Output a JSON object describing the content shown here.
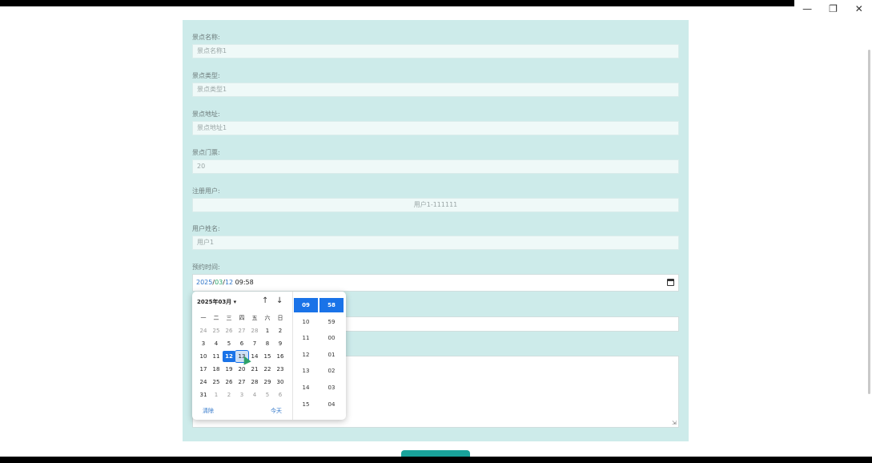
{
  "window": {
    "minimize_icon": "minimize-icon",
    "maximize_icon": "restore-icon",
    "close_icon": "close-icon"
  },
  "form": {
    "fields": [
      {
        "label": "景点名称:",
        "value": "景点名称1"
      },
      {
        "label": "景点类型:",
        "value": "景点类型1"
      },
      {
        "label": "景点地址:",
        "value": "景点地址1"
      },
      {
        "label": "景点门票:",
        "value": "20"
      },
      {
        "label": "注册用户:",
        "value": "用户1-111111"
      },
      {
        "label": "用户姓名:",
        "value": "用户1"
      },
      {
        "label": "预约时间:",
        "value": ""
      }
    ],
    "datetime": {
      "year": "2025",
      "sep1": "/",
      "month": "03",
      "sep2": "/",
      "day": "12",
      "time": " 09:58"
    }
  },
  "picker": {
    "month_label": "2025年03月 ▾",
    "nav_up": "↑",
    "nav_down": "↓",
    "weekdays": [
      "一",
      "二",
      "三",
      "四",
      "五",
      "六",
      "日"
    ],
    "days": [
      [
        "24",
        "25",
        "26",
        "27",
        "28",
        "1",
        "2"
      ],
      [
        "3",
        "4",
        "5",
        "6",
        "7",
        "8",
        "9"
      ],
      [
        "10",
        "11",
        "12",
        "13",
        "14",
        "15",
        "16"
      ],
      [
        "17",
        "18",
        "19",
        "20",
        "21",
        "22",
        "23"
      ],
      [
        "24",
        "25",
        "26",
        "27",
        "28",
        "29",
        "30"
      ],
      [
        "31",
        "1",
        "2",
        "3",
        "4",
        "5",
        "6"
      ]
    ],
    "selected_day": "12",
    "hover_day": "13",
    "clear_label": "清除",
    "today_label": "今天",
    "hours": [
      "09",
      "10",
      "11",
      "12",
      "13",
      "14",
      "15"
    ],
    "minutes": [
      "58",
      "59",
      "00",
      "01",
      "02",
      "03",
      "04"
    ],
    "selected_hour": "09",
    "selected_minute": "58"
  },
  "colors": {
    "panel": "#cdebea",
    "accent": "#1a73e8",
    "submit": "#19a29a"
  }
}
